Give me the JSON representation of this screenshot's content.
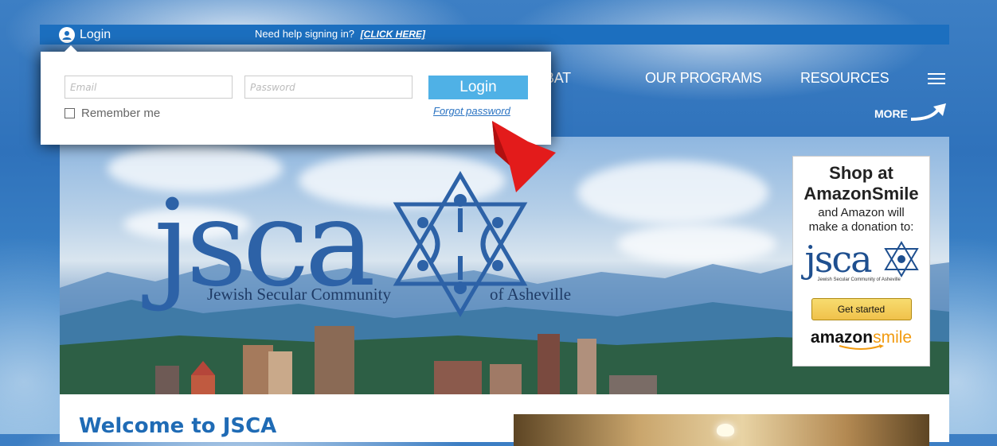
{
  "topbar": {
    "login_label": "Login",
    "help_text": "Need help signing in?",
    "help_link": "[CLICK HERE]"
  },
  "login_form": {
    "email_placeholder": "Email",
    "password_placeholder": "Password",
    "login_button": "Login",
    "remember_label": "Remember me",
    "forgot_link": "Forgot password"
  },
  "nav": {
    "items": [
      "BAT",
      "OUR PROGRAMS",
      "RESOURCES"
    ],
    "more_label": "MORE"
  },
  "banner": {
    "logo_text": "jsca",
    "subtitle_left": "Jewish Secular Community",
    "subtitle_right": "of Asheville"
  },
  "amazon_ad": {
    "title_line1": "Shop at",
    "title_line2": "AmazonSmile",
    "sub_line1": "and Amazon will",
    "sub_line2": "make a donation to:",
    "logo_text": "jsca",
    "logo_caption": "Jewish Secular Community of Asheville",
    "button": "Get started",
    "brand_main": "amazon",
    "brand_smile": "smile"
  },
  "content": {
    "welcome_title": "Welcome to JSCA"
  },
  "colors": {
    "topbar": "#1c6fbf",
    "login_button": "#4fb1e6",
    "welcome": "#1f6bb5",
    "arrow": "#e31b1b"
  }
}
